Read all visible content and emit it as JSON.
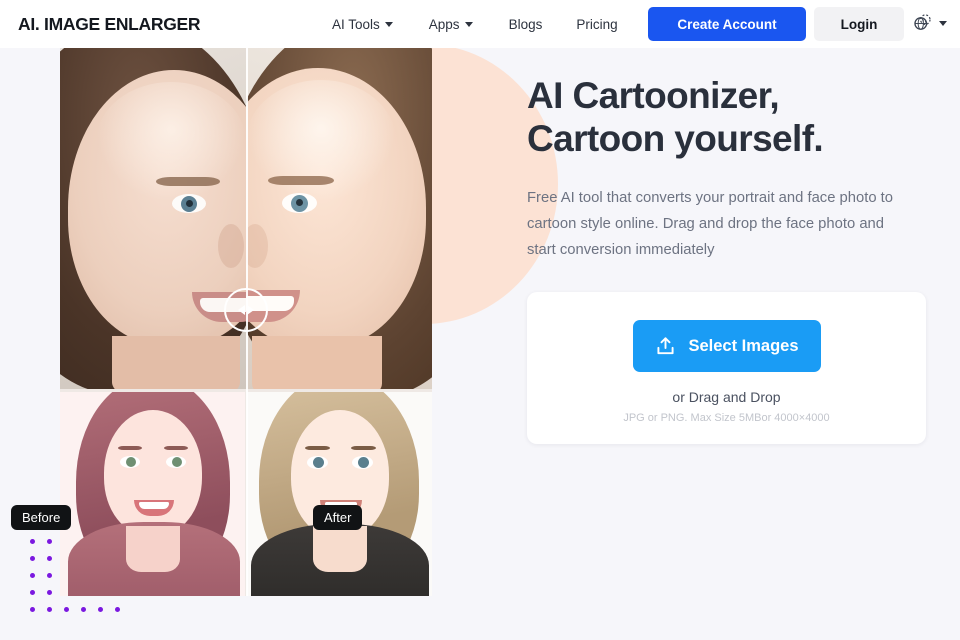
{
  "header": {
    "logo": "AI. IMAGE ENLARGER",
    "nav": [
      {
        "label": "AI Tools",
        "has_caret": true
      },
      {
        "label": "Apps",
        "has_caret": true
      },
      {
        "label": "Blogs",
        "has_caret": false
      },
      {
        "label": "Pricing",
        "has_caret": false
      }
    ],
    "create_account_label": "Create Account",
    "login_label": "Login",
    "language_icon": "globe-language-icon",
    "accent_blue": "#1a56f0",
    "login_bg": "#f2f2f4"
  },
  "hero": {
    "headline_line1": "AI Cartoonizer,",
    "headline_line2": "Cartoon yourself.",
    "subtext": "Free AI tool that converts your portrait and face photo to cartoon style online. Drag and drop the face photo and start conversion immediately",
    "headline_color": "#2a303c",
    "decor_circle_color": "#fce2d4"
  },
  "upload": {
    "select_images_label": "Select Images",
    "upload_icon": "upload-tray-icon",
    "drag_text": "or Drag and Drop",
    "limit_text": "JPG or PNG. Max Size 5MBor 4000×4000",
    "button_color": "#1a9cf5"
  },
  "showcase": {
    "before_label": "Before",
    "after_label": "After",
    "slider_icon": "left-right-arrows-icon",
    "dot_color": "#7b18e0"
  }
}
